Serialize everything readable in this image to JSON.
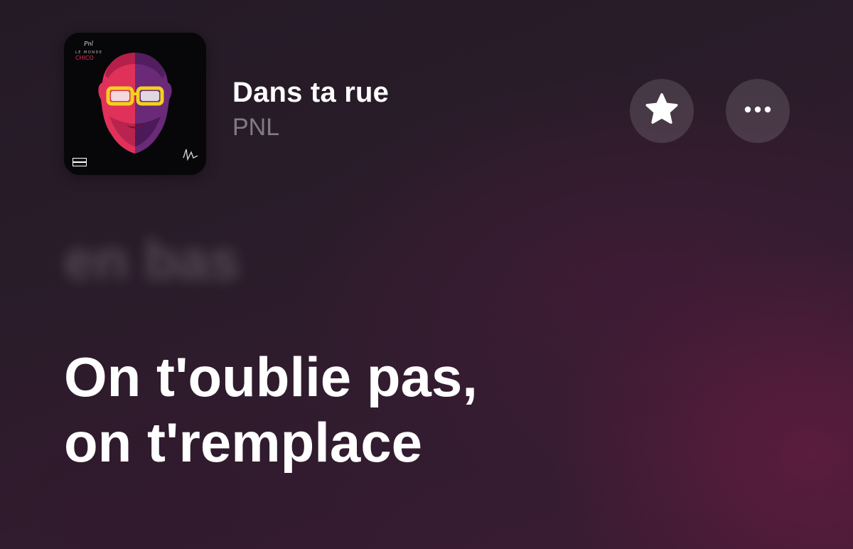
{
  "track": {
    "title": "Dans ta rue",
    "artist": "PNL",
    "album_art": {
      "label": "CHICO",
      "header": "LE MONDE",
      "badge": "PARENTAL ADVISORY"
    }
  },
  "actions": {
    "favorite_icon": "star-icon",
    "more_icon": "more-options-icon"
  },
  "lyrics": {
    "previous_line": "en bas",
    "current_lines": [
      "On t'oublie pas,",
      "on t'remplace"
    ]
  },
  "colors": {
    "text_primary": "#ffffff",
    "text_secondary": "rgba(255,255,255,0.42)",
    "album_face_red": "#e0315a",
    "album_face_purple": "#6a2a78",
    "glasses_yellow": "#f2d21c"
  }
}
